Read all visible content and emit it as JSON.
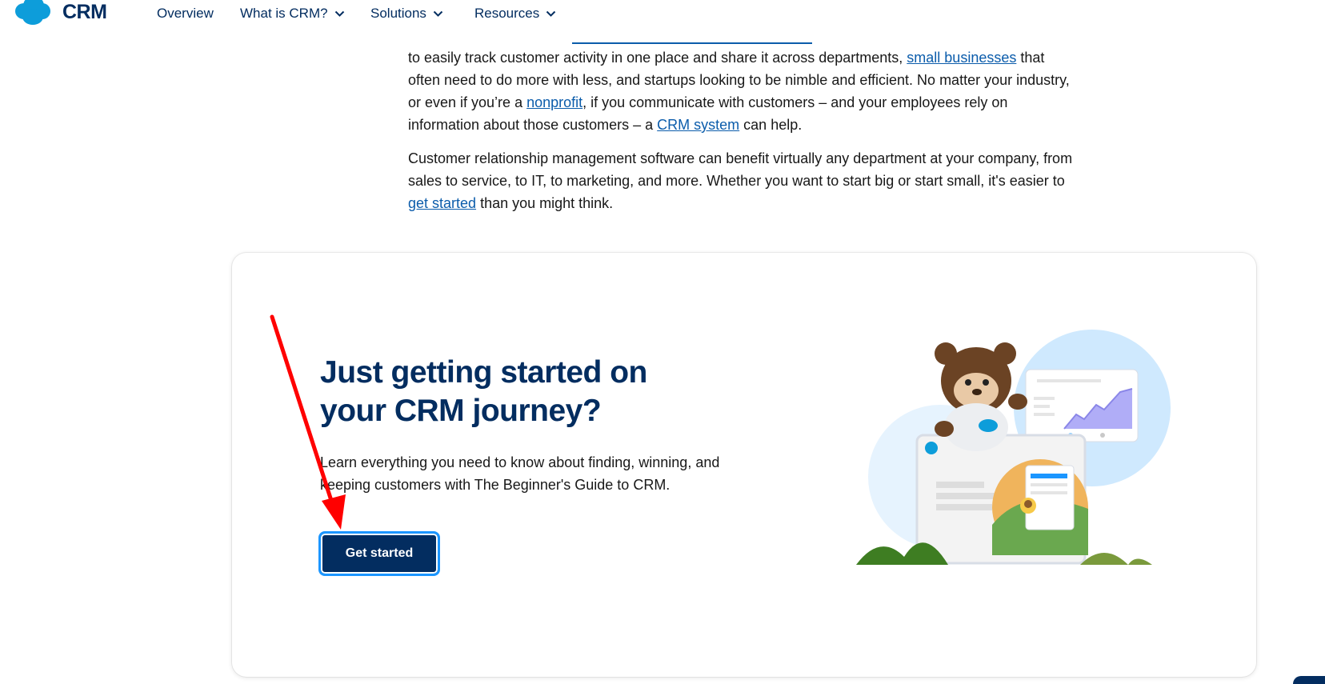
{
  "nav": {
    "brand": "CRM",
    "items": [
      {
        "label": "Overview",
        "has_dropdown": false
      },
      {
        "label": "What is CRM?",
        "has_dropdown": true
      },
      {
        "label": "Solutions",
        "has_dropdown": true
      },
      {
        "label": "Resources",
        "has_dropdown": true
      }
    ]
  },
  "article": {
    "p1": {
      "t1": "to easily track customer activity in one place and share it across departments, ",
      "link1": "small businesses",
      "t2": " that often need to do more with less, and startups looking to be nimble and efficient. No matter your industry, or even if you’re a ",
      "link2": "nonprofit",
      "t3": ", if you communicate with customers – and your employees rely on information about those customers – a ",
      "link3": "CRM system",
      "t4": " can help."
    },
    "p2": {
      "t1": "Customer relationship management software can benefit virtually any department at your company, from sales to service, to IT, to marketing, and more. Whether you want to start big or start small, it's easier to ",
      "link1": "get started",
      "t2": " than you might think."
    }
  },
  "card": {
    "title": "Just getting started on your CRM journey?",
    "text": "Learn everything you need to know about finding, winning, and keeping customers with The Beginner's Guide to CRM.",
    "button_label": "Get started"
  },
  "colors": {
    "brand_navy": "#032d60",
    "link_blue": "#0b5cab",
    "focus_ring": "#1b96ff",
    "annotation_red": "#ff0000"
  }
}
